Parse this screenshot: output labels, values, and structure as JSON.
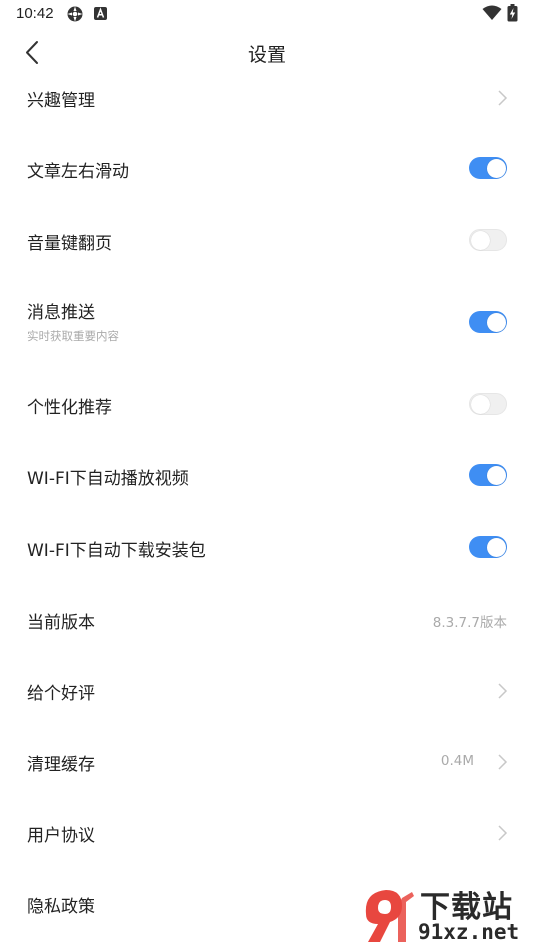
{
  "status_bar": {
    "time": "10:42",
    "icons": [
      "gear-flower-icon",
      "a-box-icon",
      "wifi-icon",
      "battery-charging-icon"
    ]
  },
  "nav": {
    "title": "设置",
    "back_icon": "chevron-left-icon"
  },
  "settings": [
    {
      "label": "兴趣管理",
      "type": "link"
    },
    {
      "label": "文章左右滑动",
      "type": "toggle",
      "on": true
    },
    {
      "label": "音量键翻页",
      "type": "toggle",
      "on": false
    },
    {
      "label": "消息推送",
      "subtitle": "实时获取重要内容",
      "type": "toggle",
      "on": true
    },
    {
      "label": "个性化推荐",
      "type": "toggle",
      "on": false
    },
    {
      "label": "WI-FI下自动播放视频",
      "type": "toggle",
      "on": true
    },
    {
      "label": "WI-FI下自动下载安装包",
      "type": "toggle",
      "on": true
    },
    {
      "label": "当前版本",
      "type": "value",
      "value": "8.3.7.7版本"
    },
    {
      "label": "给个好评",
      "type": "link"
    },
    {
      "label": "清理缓存",
      "type": "link",
      "value": "0.4M"
    },
    {
      "label": "用户协议",
      "type": "link"
    },
    {
      "label": "隐私政策",
      "type": "link"
    }
  ],
  "watermark": {
    "line1": "下载站",
    "line2": "91xz.net"
  },
  "colors": {
    "toggle_on": "#3f8ef3",
    "toggle_off": "#f0f0f0",
    "text_primary": "#222222",
    "text_secondary": "#aaaaaa",
    "watermark_red": "#e8473f"
  }
}
